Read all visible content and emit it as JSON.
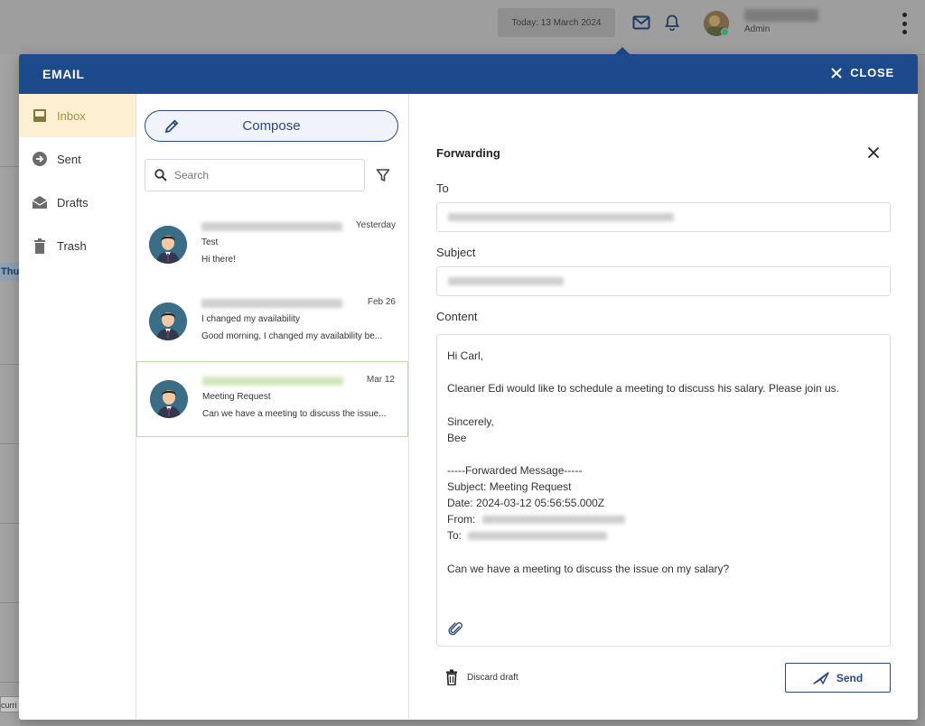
{
  "topbar": {
    "today": "Today: 13 March 2024",
    "user_role": "Admin"
  },
  "background": {
    "calendar_day_fragment": "Thu",
    "footer_fragment": "curri"
  },
  "modal": {
    "title": "EMAIL",
    "close_label": "CLOSE"
  },
  "folders": [
    {
      "label": "Inbox",
      "icon": "inbox-icon",
      "active": true
    },
    {
      "label": "Sent",
      "icon": "sent-icon",
      "active": false
    },
    {
      "label": "Drafts",
      "icon": "drafts-icon",
      "active": false
    },
    {
      "label": "Trash",
      "icon": "trash-icon",
      "active": false
    }
  ],
  "list": {
    "compose_label": "Compose",
    "search_placeholder": "Search",
    "messages": [
      {
        "date": "Yesterday",
        "subject": "Test",
        "preview": "Hi there!",
        "selected": false
      },
      {
        "date": "Feb 26",
        "subject": "I changed my availability",
        "preview": "Good morning, I changed my availability be...",
        "selected": false
      },
      {
        "date": "Mar 12",
        "subject": "Meeting Request",
        "preview": "Can we have a meeting to discuss the issue...",
        "selected": true
      }
    ]
  },
  "form": {
    "title": "Forwarding",
    "to_label": "To",
    "subject_label": "Subject",
    "content_label": "Content",
    "content": {
      "greeting": "Hi Carl,",
      "body": "Cleaner Edi would like to schedule a meeting to discuss his salary. Please join us.",
      "signoff": "Sincerely,",
      "signature": "Bee",
      "fwd_header": "-----Forwarded Message-----",
      "fwd_subject": "Subject: Meeting Request",
      "fwd_date": "Date: 2024-03-12 05:56:55.000Z",
      "fwd_from": "From:",
      "fwd_to": "To:",
      "fwd_body": "Can we have a meeting to discuss the issue on my salary?"
    },
    "discard_label": "Discard draft",
    "send_label": "Send"
  },
  "colors": {
    "header_blue": "#1d4a8a",
    "accent_navy": "#2b4a7a",
    "active_folder_bg": "#fdf0d2",
    "selected_border": "#b9dca0"
  }
}
